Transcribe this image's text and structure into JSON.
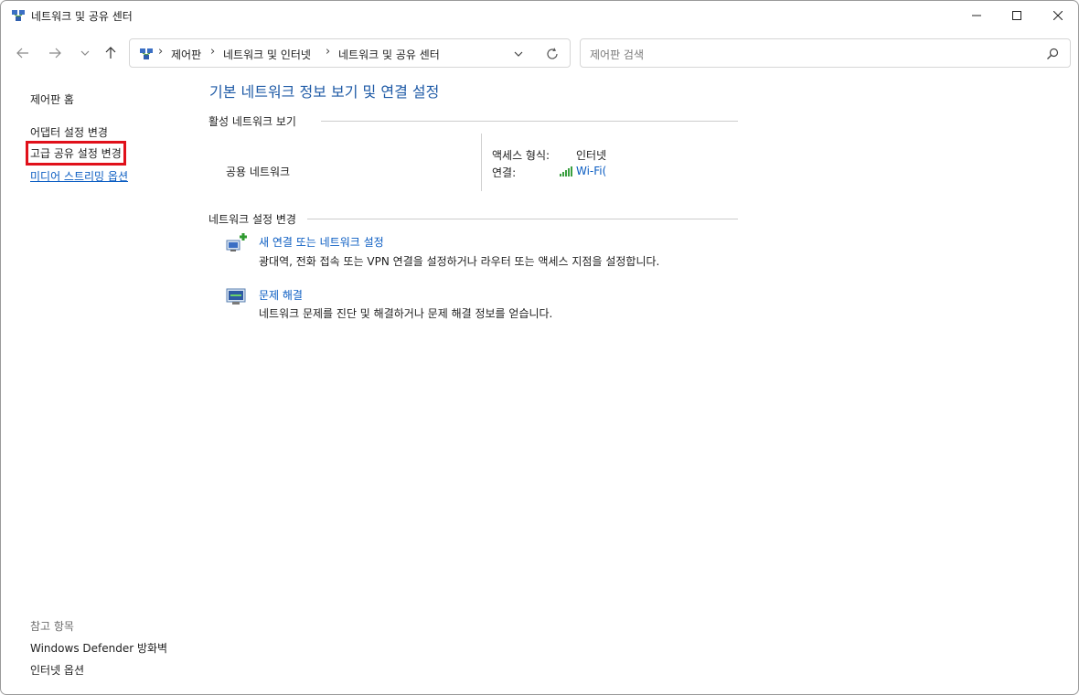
{
  "window": {
    "title": "네트워크 및 공유 센터"
  },
  "address": {
    "crumbs": [
      "제어판",
      "네트워크 및 인터넷",
      "네트워크 및 공유 센터"
    ]
  },
  "search": {
    "placeholder": "제어판 검색"
  },
  "left_nav": {
    "home": "제어판 홈",
    "adapter": "어댑터 설정 변경",
    "advanced_sharing": "고급 공유 설정 변경",
    "media_streaming": "미디어 스트리밍 옵션",
    "see_also_heading": "참고 항목",
    "firewall": "Windows Defender 방화벽",
    "internet_options": "인터넷 옵션"
  },
  "main": {
    "title": "기본 네트워크 정보 보기 및 연결 설정",
    "active_heading": "활성 네트워크 보기",
    "network_name": "공용 네트워크",
    "access_type_label": "액세스 형식:",
    "access_type_value": "인터넷",
    "connection_label": "연결:",
    "connection_value": "Wi-Fi(",
    "change_heading": "네트워크 설정 변경",
    "task1_link": "새 연결 또는 네트워크 설정",
    "task1_desc": "광대역, 전화 접속 또는 VPN 연결을 설정하거나 라우터 또는 액세스 지점을 설정합니다.",
    "task2_link": "문제 해결",
    "task2_desc": "네트워크 문제를 진단 및 해결하거나 문제 해결 정보를 얻습니다."
  },
  "colors": {
    "link": "#0a5cc2",
    "title": "#1e5aa6",
    "highlight": "#e0101a",
    "signal": "#3aa040"
  },
  "icons": [
    "network-center-icon",
    "minimize-icon",
    "maximize-icon",
    "close-icon",
    "back-arrow-icon",
    "forward-arrow-icon",
    "chevron-down-icon",
    "up-arrow-icon",
    "refresh-icon",
    "search-icon",
    "wifi-signal-icon",
    "new-connection-icon",
    "troubleshoot-icon"
  ]
}
